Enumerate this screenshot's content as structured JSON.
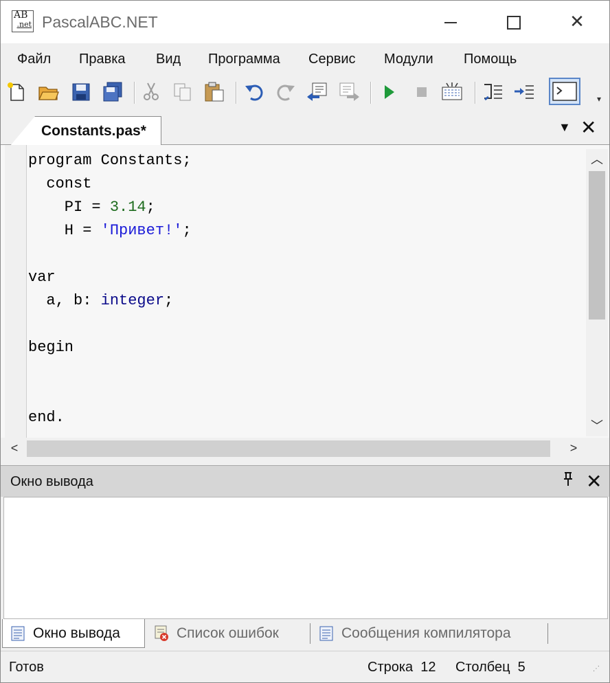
{
  "window": {
    "title": "PascalABC.NET"
  },
  "menu": [
    "Файл",
    "Правка",
    "Вид",
    "Программа",
    "Сервис",
    "Модули",
    "Помощь"
  ],
  "editor": {
    "tab_label": "Constants.pas*",
    "code_lines": [
      [
        {
          "t": "program Constants;",
          "c": "kw0"
        }
      ],
      [
        {
          "t": "  const",
          "c": "kw0"
        }
      ],
      [
        {
          "t": "    PI = ",
          "c": "n"
        },
        {
          "t": "3.14",
          "c": "num"
        },
        {
          "t": ";",
          "c": "n"
        }
      ],
      [
        {
          "t": "    H = ",
          "c": "n"
        },
        {
          "t": "'Привет!'",
          "c": "str"
        },
        {
          "t": ";",
          "c": "n"
        }
      ],
      [
        {
          "t": "",
          "c": "n"
        }
      ],
      [
        {
          "t": "var",
          "c": "n"
        }
      ],
      [
        {
          "t": "  a, b: ",
          "c": "n"
        },
        {
          "t": "integer",
          "c": "typ"
        },
        {
          "t": ";",
          "c": "n"
        }
      ],
      [
        {
          "t": "",
          "c": "n"
        }
      ],
      [
        {
          "t": "begin",
          "c": "n"
        }
      ],
      [
        {
          "t": "",
          "c": "n"
        }
      ],
      [
        {
          "t": "",
          "c": "n"
        }
      ],
      [
        {
          "t": "end.",
          "c": "n"
        }
      ]
    ]
  },
  "output_panel": {
    "title": "Окно вывода"
  },
  "bottom_tabs": {
    "output": "Окно вывода",
    "errors": "Список ошибок",
    "compiler": "Сообщения компилятора"
  },
  "status": {
    "ready": "Готов",
    "row_label": "Строка",
    "row_value": "12",
    "col_label": "Столбец",
    "col_value": "5"
  },
  "icons": {
    "toolbar": [
      "new-file-icon",
      "open-folder-icon",
      "save-icon",
      "save-all-icon",
      "cut-icon",
      "copy-icon",
      "paste-icon",
      "undo-icon",
      "redo-icon",
      "navigate-back-icon",
      "navigate-forward-icon",
      "run-icon",
      "stop-icon",
      "compile-icon",
      "step-into-icon",
      "step-over-icon",
      "output-window-icon"
    ]
  },
  "colors": {
    "number": "#1d6b1d",
    "string": "#1b1bd8",
    "type": "#0b0b8a",
    "accent": "#5a86c8"
  }
}
